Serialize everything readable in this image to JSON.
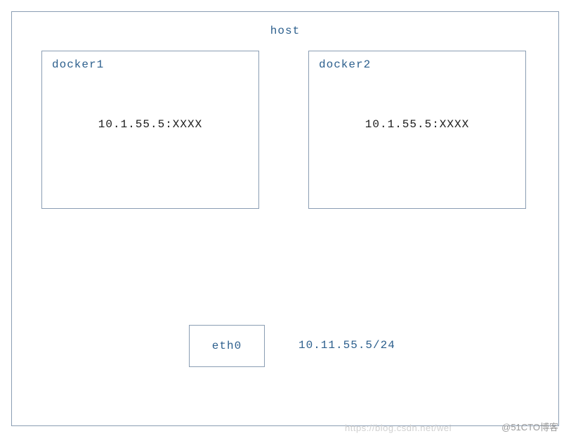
{
  "host": {
    "label": "host"
  },
  "containers": {
    "docker1": {
      "label": "docker1",
      "ip": "10.1.55.5:XXXX"
    },
    "docker2": {
      "label": "docker2",
      "ip": "10.1.55.5:XXXX"
    }
  },
  "interface": {
    "name": "eth0",
    "ip": "10.11.55.5/24"
  },
  "watermark": {
    "left": "https://blog.csdn.net/wei",
    "right": "@51CTO博客"
  }
}
